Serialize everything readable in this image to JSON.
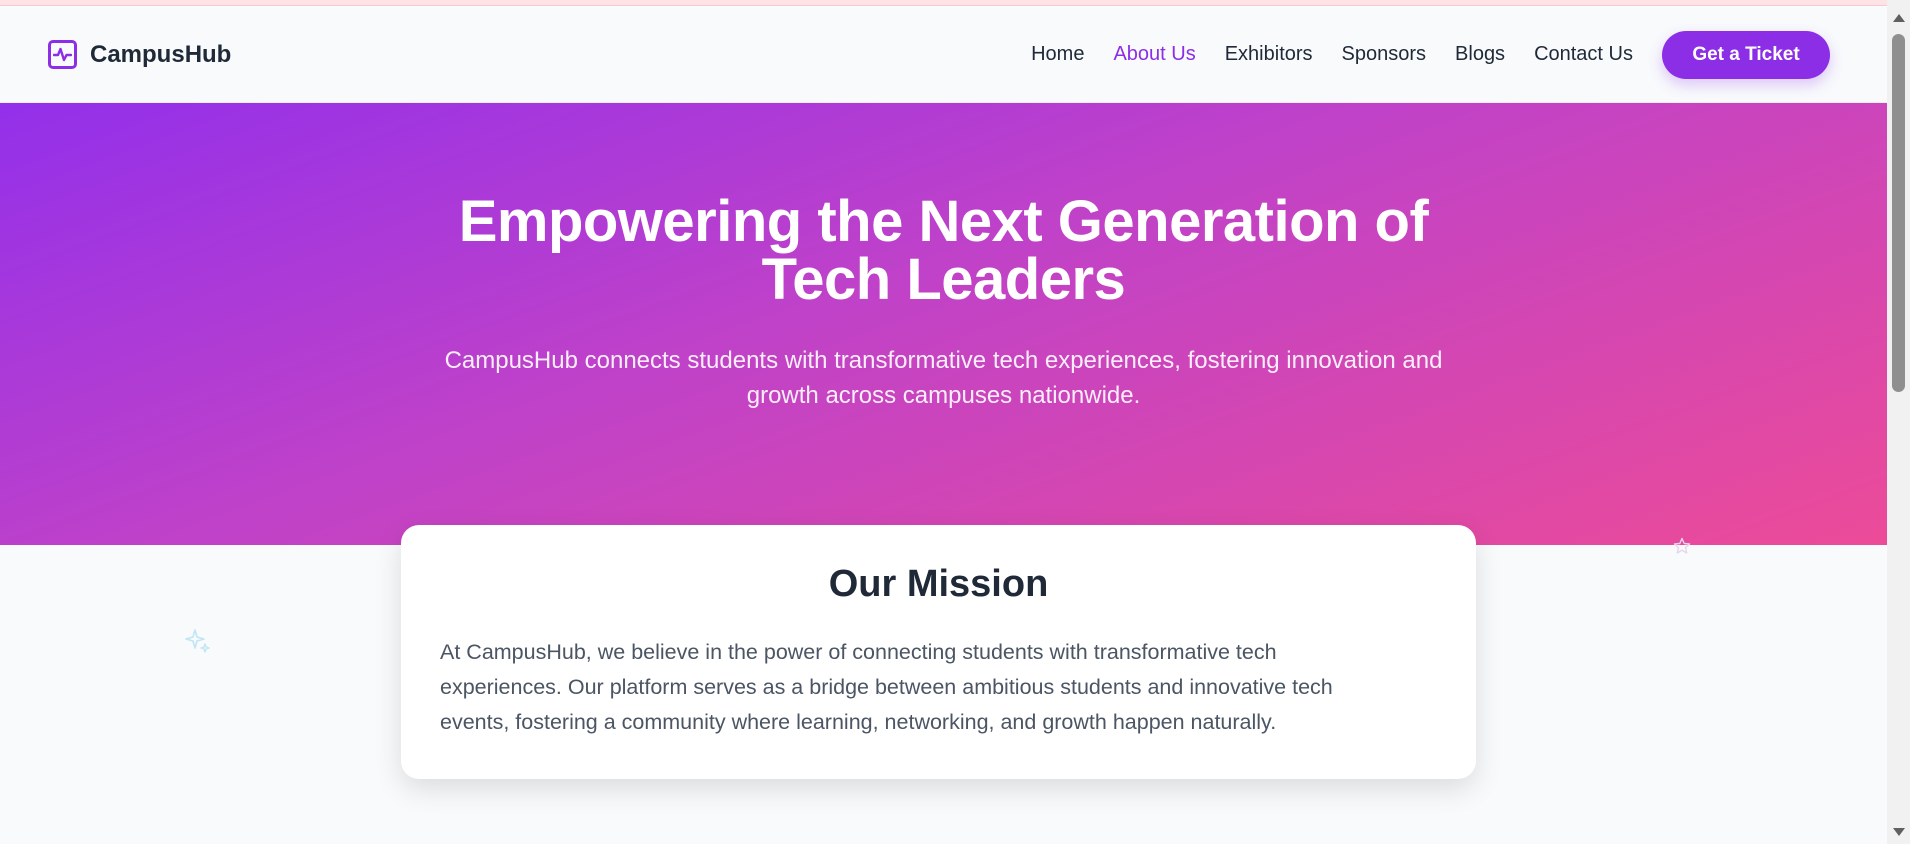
{
  "brand": {
    "name": "CampusHub",
    "icon": "activity-pulse-icon",
    "accent": "#8b2ee6"
  },
  "nav": {
    "links": [
      {
        "label": "Home",
        "active": false
      },
      {
        "label": "About Us",
        "active": true
      },
      {
        "label": "Exhibitors",
        "active": false
      },
      {
        "label": "Sponsors",
        "active": false
      },
      {
        "label": "Blogs",
        "active": false
      },
      {
        "label": "Contact Us",
        "active": false
      }
    ],
    "cta_label": "Get a Ticket"
  },
  "hero": {
    "title_line1": "Empowering the Next Generation of",
    "title_line2": "Tech Leaders",
    "subtitle_line1": "CampusHub connects students with transformative tech experiences, fostering innovation and",
    "subtitle_line2": "growth across campuses nationwide.",
    "gradient": [
      "#9330ea",
      "#ec4b98"
    ]
  },
  "mission": {
    "title": "Our Mission",
    "body_line1": "At CampusHub, we believe in the power of connecting students with transformative tech",
    "body_line2": "experiences. Our platform serves as a bridge between ambitious students and innovative tech",
    "body_line3": "events, fostering a community where learning, networking, and growth happen naturally."
  },
  "decorations": {
    "left": "sparkle-icon",
    "right": "star-icon"
  }
}
